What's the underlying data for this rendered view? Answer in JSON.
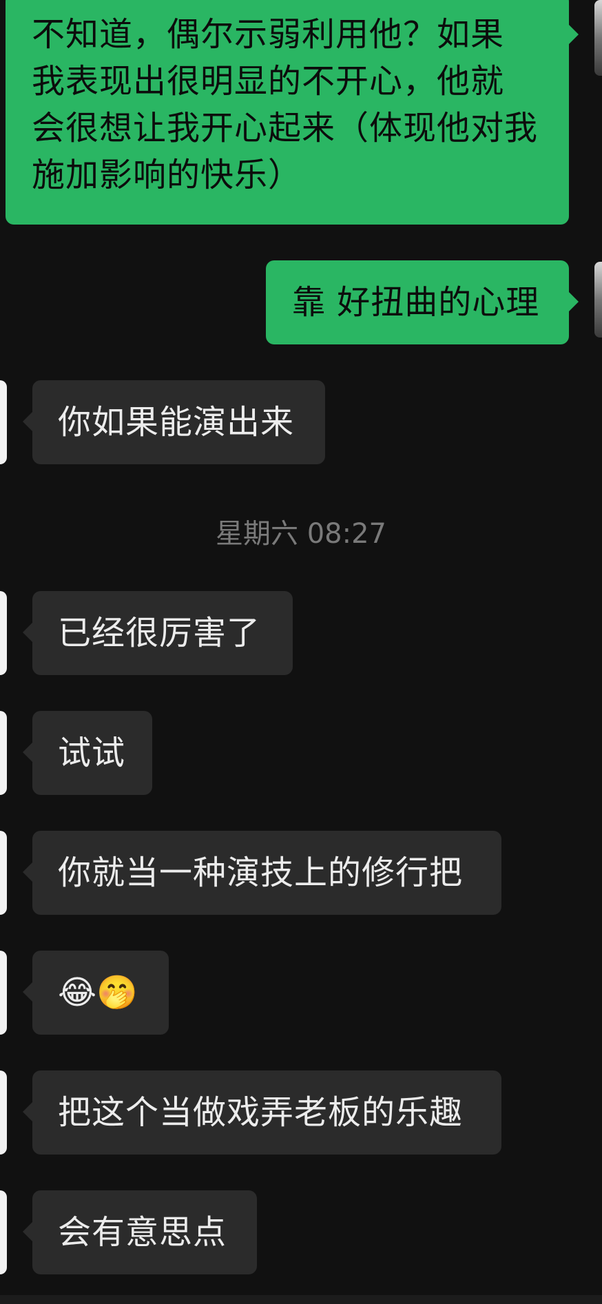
{
  "messages": [
    {
      "side": "outgoing",
      "lines": [
        "不知道，偶尔示弱利用他？如果",
        "我表现出很明显的不开心，他就",
        "会很想让我开心起来（体现他对我",
        "施加影响的快乐）"
      ]
    },
    {
      "side": "outgoing",
      "text": "靠 好扭曲的心理"
    },
    {
      "side": "incoming",
      "text": "你如果能演出来"
    },
    {
      "side": "incoming",
      "text": "已经很厉害了"
    },
    {
      "side": "incoming",
      "text": "试试"
    },
    {
      "side": "incoming",
      "text": "你就当一种演技上的修行把"
    },
    {
      "side": "incoming",
      "text": "😂🤭"
    },
    {
      "side": "incoming",
      "text": "把这个当做戏弄老板的乐趣"
    },
    {
      "side": "incoming",
      "text": "会有意思点"
    }
  ],
  "timestamp": "星期六 08:27",
  "colors": {
    "background": "#111111",
    "outgoing_bubble": "#2ab663",
    "incoming_bubble": "#2b2b2b",
    "timestamp_text": "#7a7a7a"
  }
}
